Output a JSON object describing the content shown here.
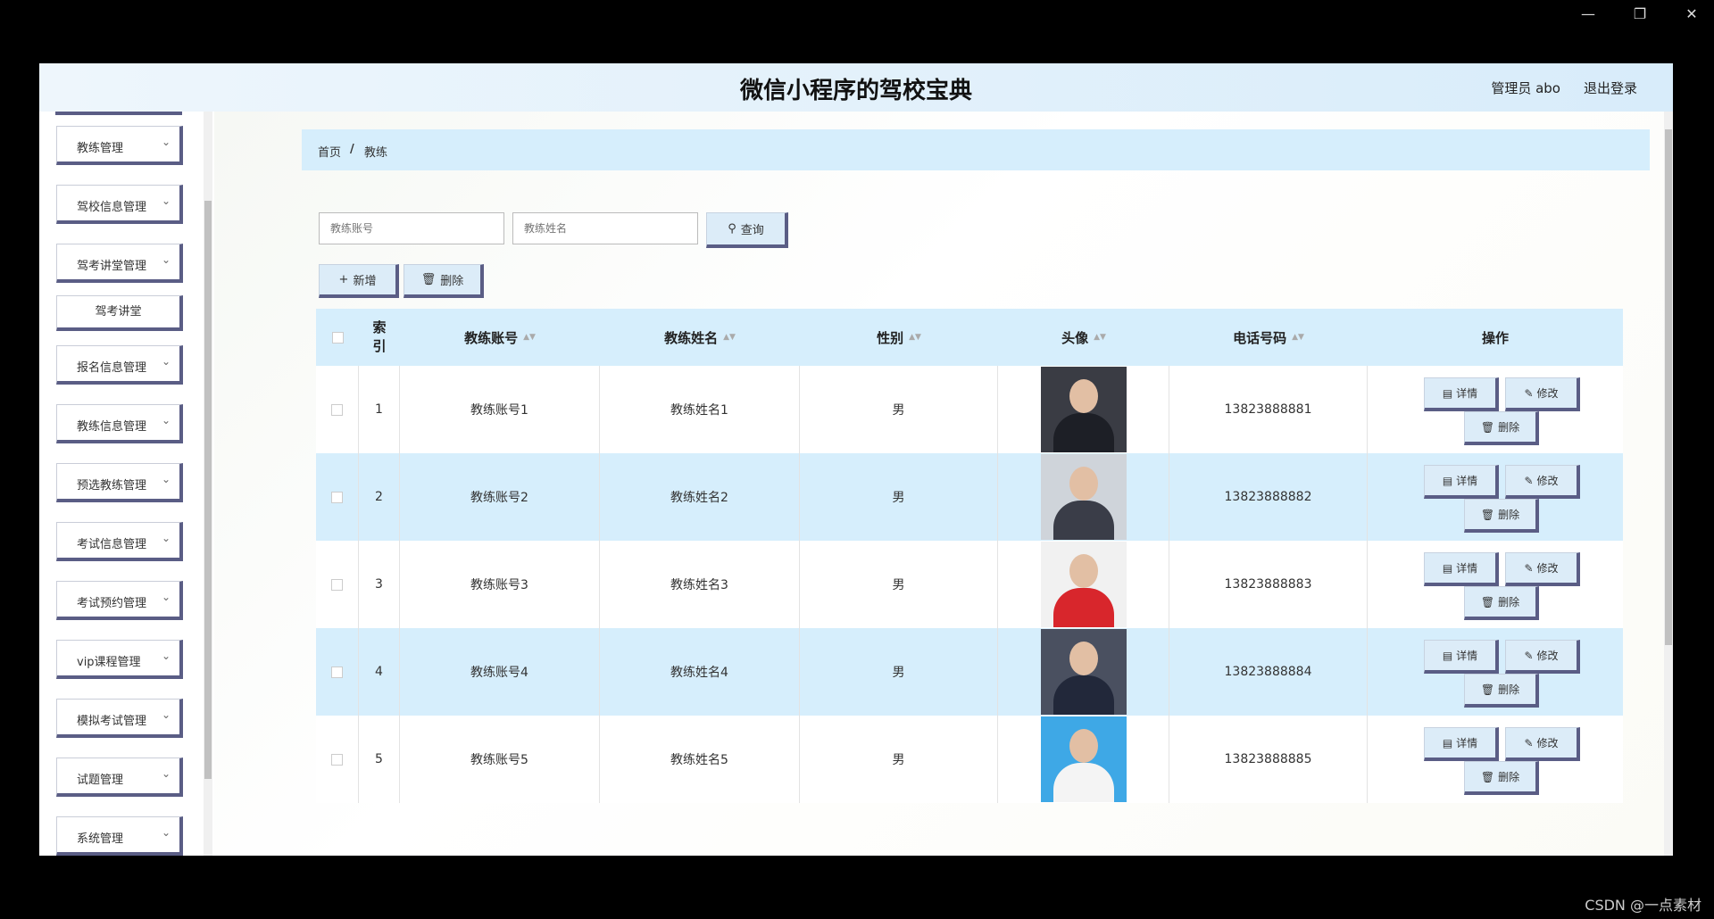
{
  "app_title": "微信小程序的驾校宝典",
  "header": {
    "user": "管理员 abo",
    "logout": "退出登录"
  },
  "sidebar": {
    "items": [
      {
        "label": "教练管理"
      },
      {
        "label": "驾校信息管理"
      },
      {
        "label": "驾考讲堂管理"
      },
      {
        "label": "报名信息管理"
      },
      {
        "label": "教练信息管理"
      },
      {
        "label": "预选教练管理"
      },
      {
        "label": "考试信息管理"
      },
      {
        "label": "考试预约管理"
      },
      {
        "label": "vip课程管理"
      },
      {
        "label": "模拟考试管理"
      },
      {
        "label": "试题管理"
      },
      {
        "label": "系统管理"
      }
    ],
    "submenu": {
      "label": "驾考讲堂"
    }
  },
  "breadcrumb": {
    "home": "首页",
    "sep": "/",
    "current": "教练"
  },
  "search": {
    "account_placeholder": "教练账号",
    "name_placeholder": "教练姓名",
    "query_label": "查询"
  },
  "toolbar": {
    "add_label": "新增",
    "delete_label": "删除"
  },
  "table": {
    "headers": {
      "index": "索引",
      "account": "教练账号",
      "name": "教练姓名",
      "gender": "性别",
      "avatar": "头像",
      "phone": "电话号码",
      "ops": "操作"
    },
    "ops_labels": {
      "detail": "详情",
      "edit": "修改",
      "delete": "删除"
    },
    "rows": [
      {
        "index": "1",
        "account": "教练账号1",
        "name": "教练姓名1",
        "gender": "男",
        "phone": "13823888881"
      },
      {
        "index": "2",
        "account": "教练账号2",
        "name": "教练姓名2",
        "gender": "男",
        "phone": "13823888882"
      },
      {
        "index": "3",
        "account": "教练账号3",
        "name": "教练姓名3",
        "gender": "男",
        "phone": "13823888883"
      },
      {
        "index": "4",
        "account": "教练账号4",
        "name": "教练姓名4",
        "gender": "男",
        "phone": "13823888884"
      },
      {
        "index": "5",
        "account": "教练账号5",
        "name": "教练姓名5",
        "gender": "男",
        "phone": "13823888885"
      }
    ]
  },
  "colors": {
    "accent": "#5a5d85",
    "header_bg": "#d6eefc"
  },
  "watermark": "CSDN @一点素材"
}
